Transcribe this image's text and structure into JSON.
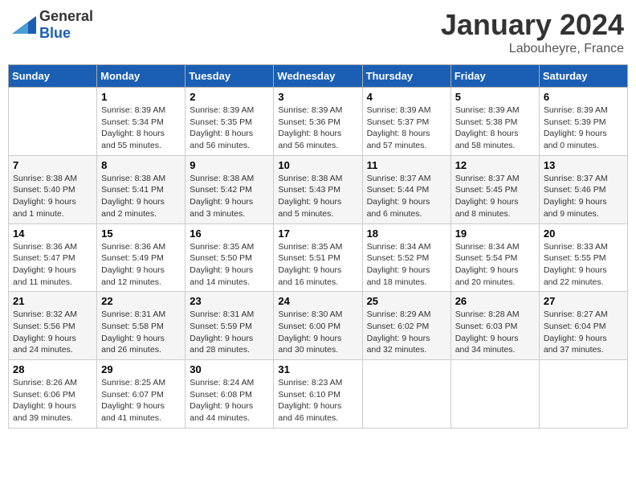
{
  "header": {
    "logo_general": "General",
    "logo_blue": "Blue",
    "month_year": "January 2024",
    "location": "Labouheyre, France"
  },
  "days_of_week": [
    "Sunday",
    "Monday",
    "Tuesday",
    "Wednesday",
    "Thursday",
    "Friday",
    "Saturday"
  ],
  "weeks": [
    [
      {
        "day": "",
        "info": ""
      },
      {
        "day": "1",
        "info": "Sunrise: 8:39 AM\nSunset: 5:34 PM\nDaylight: 8 hours\nand 55 minutes."
      },
      {
        "day": "2",
        "info": "Sunrise: 8:39 AM\nSunset: 5:35 PM\nDaylight: 8 hours\nand 56 minutes."
      },
      {
        "day": "3",
        "info": "Sunrise: 8:39 AM\nSunset: 5:36 PM\nDaylight: 8 hours\nand 56 minutes."
      },
      {
        "day": "4",
        "info": "Sunrise: 8:39 AM\nSunset: 5:37 PM\nDaylight: 8 hours\nand 57 minutes."
      },
      {
        "day": "5",
        "info": "Sunrise: 8:39 AM\nSunset: 5:38 PM\nDaylight: 8 hours\nand 58 minutes."
      },
      {
        "day": "6",
        "info": "Sunrise: 8:39 AM\nSunset: 5:39 PM\nDaylight: 9 hours\nand 0 minutes."
      }
    ],
    [
      {
        "day": "7",
        "info": "Sunrise: 8:38 AM\nSunset: 5:40 PM\nDaylight: 9 hours\nand 1 minute."
      },
      {
        "day": "8",
        "info": "Sunrise: 8:38 AM\nSunset: 5:41 PM\nDaylight: 9 hours\nand 2 minutes."
      },
      {
        "day": "9",
        "info": "Sunrise: 8:38 AM\nSunset: 5:42 PM\nDaylight: 9 hours\nand 3 minutes."
      },
      {
        "day": "10",
        "info": "Sunrise: 8:38 AM\nSunset: 5:43 PM\nDaylight: 9 hours\nand 5 minutes."
      },
      {
        "day": "11",
        "info": "Sunrise: 8:37 AM\nSunset: 5:44 PM\nDaylight: 9 hours\nand 6 minutes."
      },
      {
        "day": "12",
        "info": "Sunrise: 8:37 AM\nSunset: 5:45 PM\nDaylight: 9 hours\nand 8 minutes."
      },
      {
        "day": "13",
        "info": "Sunrise: 8:37 AM\nSunset: 5:46 PM\nDaylight: 9 hours\nand 9 minutes."
      }
    ],
    [
      {
        "day": "14",
        "info": "Sunrise: 8:36 AM\nSunset: 5:47 PM\nDaylight: 9 hours\nand 11 minutes."
      },
      {
        "day": "15",
        "info": "Sunrise: 8:36 AM\nSunset: 5:49 PM\nDaylight: 9 hours\nand 12 minutes."
      },
      {
        "day": "16",
        "info": "Sunrise: 8:35 AM\nSunset: 5:50 PM\nDaylight: 9 hours\nand 14 minutes."
      },
      {
        "day": "17",
        "info": "Sunrise: 8:35 AM\nSunset: 5:51 PM\nDaylight: 9 hours\nand 16 minutes."
      },
      {
        "day": "18",
        "info": "Sunrise: 8:34 AM\nSunset: 5:52 PM\nDaylight: 9 hours\nand 18 minutes."
      },
      {
        "day": "19",
        "info": "Sunrise: 8:34 AM\nSunset: 5:54 PM\nDaylight: 9 hours\nand 20 minutes."
      },
      {
        "day": "20",
        "info": "Sunrise: 8:33 AM\nSunset: 5:55 PM\nDaylight: 9 hours\nand 22 minutes."
      }
    ],
    [
      {
        "day": "21",
        "info": "Sunrise: 8:32 AM\nSunset: 5:56 PM\nDaylight: 9 hours\nand 24 minutes."
      },
      {
        "day": "22",
        "info": "Sunrise: 8:31 AM\nSunset: 5:58 PM\nDaylight: 9 hours\nand 26 minutes."
      },
      {
        "day": "23",
        "info": "Sunrise: 8:31 AM\nSunset: 5:59 PM\nDaylight: 9 hours\nand 28 minutes."
      },
      {
        "day": "24",
        "info": "Sunrise: 8:30 AM\nSunset: 6:00 PM\nDaylight: 9 hours\nand 30 minutes."
      },
      {
        "day": "25",
        "info": "Sunrise: 8:29 AM\nSunset: 6:02 PM\nDaylight: 9 hours\nand 32 minutes."
      },
      {
        "day": "26",
        "info": "Sunrise: 8:28 AM\nSunset: 6:03 PM\nDaylight: 9 hours\nand 34 minutes."
      },
      {
        "day": "27",
        "info": "Sunrise: 8:27 AM\nSunset: 6:04 PM\nDaylight: 9 hours\nand 37 minutes."
      }
    ],
    [
      {
        "day": "28",
        "info": "Sunrise: 8:26 AM\nSunset: 6:06 PM\nDaylight: 9 hours\nand 39 minutes."
      },
      {
        "day": "29",
        "info": "Sunrise: 8:25 AM\nSunset: 6:07 PM\nDaylight: 9 hours\nand 41 minutes."
      },
      {
        "day": "30",
        "info": "Sunrise: 8:24 AM\nSunset: 6:08 PM\nDaylight: 9 hours\nand 44 minutes."
      },
      {
        "day": "31",
        "info": "Sunrise: 8:23 AM\nSunset: 6:10 PM\nDaylight: 9 hours\nand 46 minutes."
      },
      {
        "day": "",
        "info": ""
      },
      {
        "day": "",
        "info": ""
      },
      {
        "day": "",
        "info": ""
      }
    ]
  ]
}
